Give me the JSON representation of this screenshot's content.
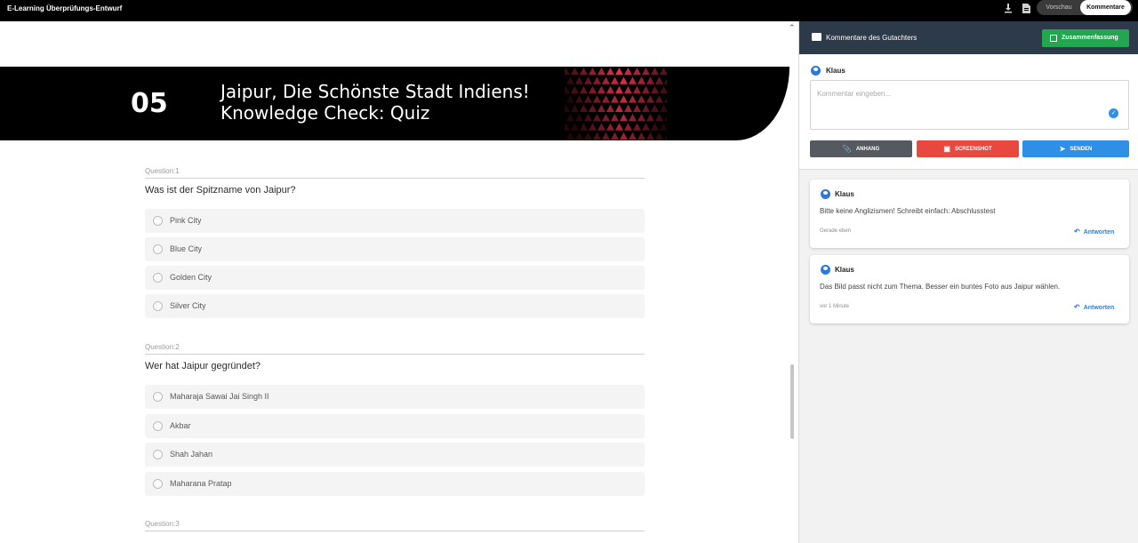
{
  "app": {
    "title": "E-Learning Überprüfungs-Entwurf"
  },
  "topbar": {
    "download_icon": "download-icon",
    "document_icon": "document-icon",
    "view_toggle": {
      "preview_label": "Vorschau",
      "comments_label": "Kommentare",
      "active": "Kommentare"
    }
  },
  "banner": {
    "number": "05",
    "title_line1": "Jaipur, Die Schönste Stadt Indiens!",
    "title_line2": "Knowledge Check: Quiz",
    "pattern_color": "#e0314b"
  },
  "questions": [
    {
      "label": "Question:1",
      "text": "Was ist der Spitzname von Jaipur?",
      "options": [
        "Pink City",
        "Blue City",
        "Golden City",
        "Silver City"
      ]
    },
    {
      "label": "Question:2",
      "text": "Wer hat Jaipur gegründet?",
      "options": [
        "Maharaja Sawai Jai Singh II",
        "Akbar",
        "Shah Jahan",
        "Maharana Pratap"
      ]
    },
    {
      "label": "Question:3"
    }
  ],
  "panel": {
    "header_title": "Kommentare des Gutachters",
    "summary_label": "Zusammenfassung",
    "composer": {
      "user": "Klaus",
      "placeholder": "Kommentar eingeben...",
      "attach_label": "ANHANG",
      "screenshot_label": "SCREENSHOT",
      "send_label": "SENDEN"
    },
    "comments": [
      {
        "user": "Klaus",
        "text": "Bitte keine Anglizismen! Schreibt einfach: Abschlusstest",
        "time": "Gerade eben",
        "reply_label": "Antworten"
      },
      {
        "user": "Klaus",
        "text": "Das Bild passt nicht zum Thema. Besser ein buntes Foto aus Jaipur wählen.",
        "time": "vor 1 Minute",
        "reply_label": "Antworten"
      }
    ]
  },
  "colors": {
    "panel_header": "#2d3a4a",
    "summary_green": "#22a650",
    "attach_gray": "#545a5f",
    "screenshot_red": "#e9483e",
    "send_blue": "#2f8fe6"
  }
}
